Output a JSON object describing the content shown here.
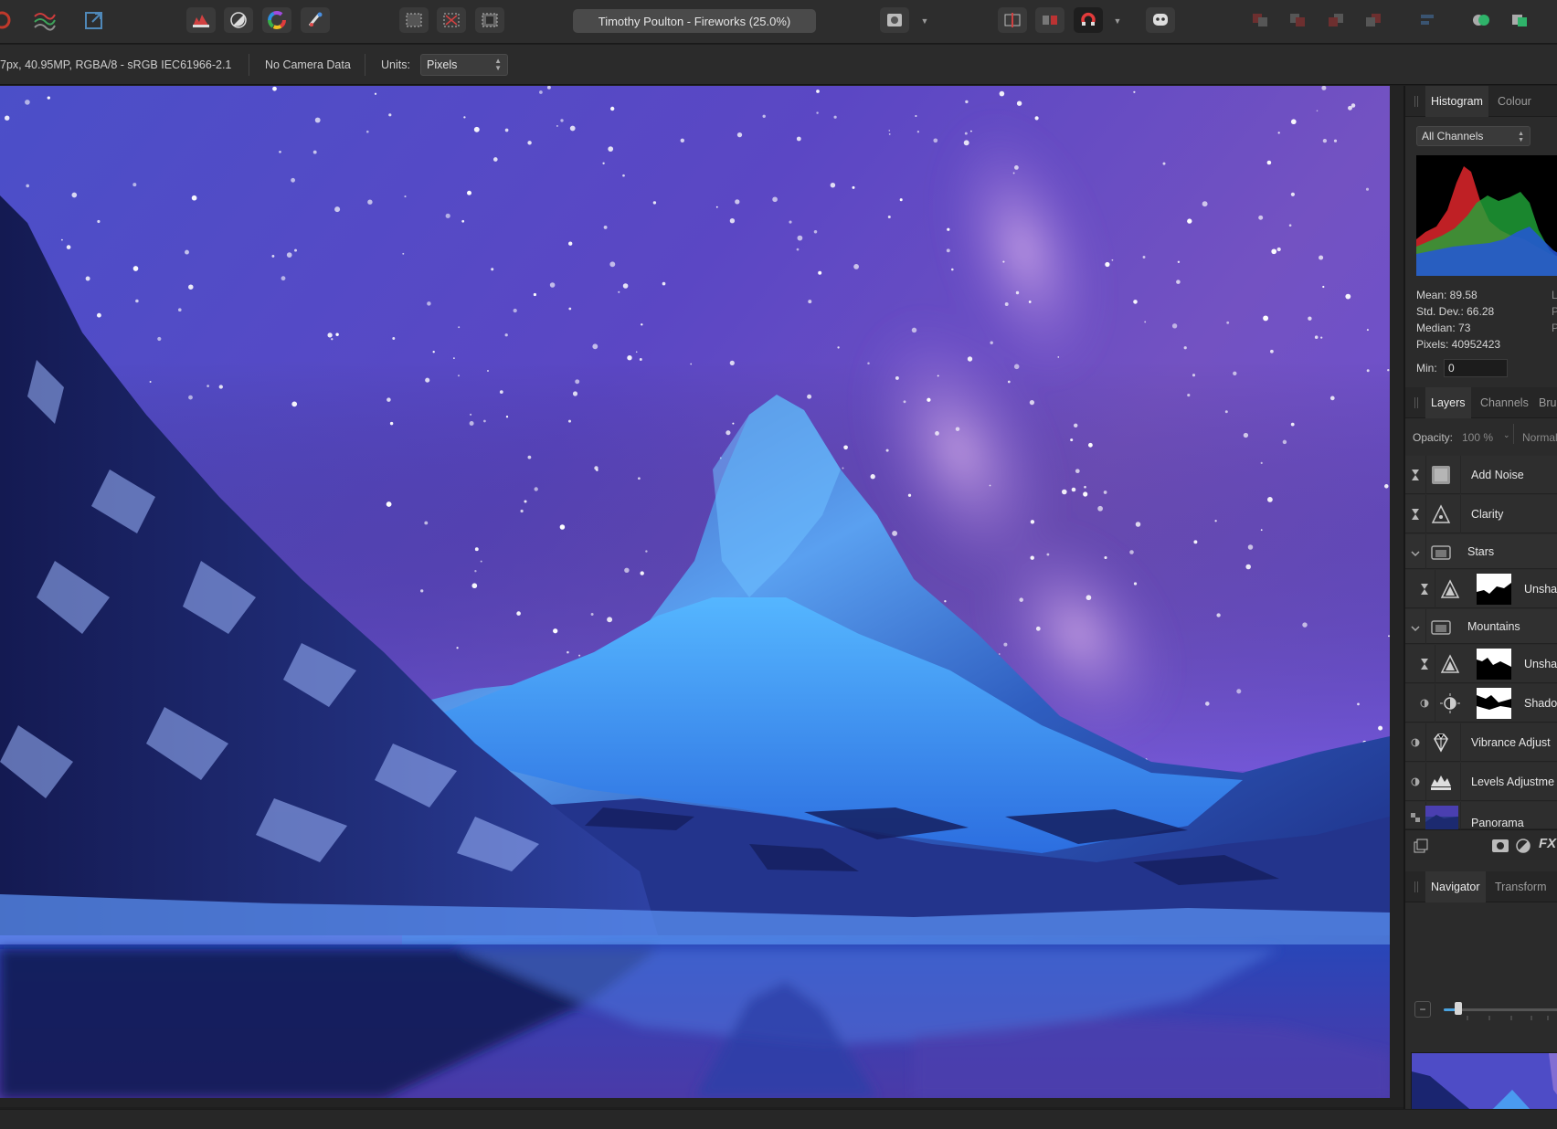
{
  "toolbar": {
    "document_title": "Timothy Poulton - Fireworks (25.0%)",
    "icons": [
      "personas-icon",
      "develop-persona-icon",
      "export-persona-icon",
      "levels-icon",
      "white-balance-icon",
      "colour-wheel-icon",
      "brush-tools-icon",
      "marquee-select-icon",
      "deselect-icon",
      "invert-selection-icon",
      "quick-mask-icon",
      "split-view-icon",
      "mirror-view-icon",
      "snapping-icon",
      "assistant-icon",
      "arrange-back-icon",
      "arrange-backward-icon",
      "arrange-forward-icon",
      "arrange-front-icon",
      "align-icon",
      "boolean-add-icon",
      "boolean-subtract-icon"
    ]
  },
  "context_bar": {
    "image_info": "7px, 40.95MP, RGBA/8 - sRGB IEC61966-2.1",
    "camera": "No Camera Data",
    "units_label": "Units:",
    "units_value": "Pixels"
  },
  "histogram_panel": {
    "tabs": [
      "Histogram",
      "Colour"
    ],
    "active_tab": "Histogram",
    "channel_select": "All Channels",
    "mean": "Mean: 89.58",
    "std_dev": "Std. Dev.: 66.28",
    "median": "Median: 73",
    "pixels": "Pixels: 40952423",
    "min_label": "Min:",
    "min_value": "0",
    "right_col": [
      "L",
      "P",
      "P"
    ],
    "colors": {
      "red": "#e1262b",
      "green": "#21a73a",
      "blue": "#2556d8"
    }
  },
  "layers_panel": {
    "tabs": [
      "Layers",
      "Channels",
      "Bru"
    ],
    "active_tab": "Layers",
    "opacity_label": "Opacity:",
    "opacity_value": "100 %",
    "blend_mode": "Normal",
    "layers": [
      {
        "name": "Add Noise",
        "icon": "noise-filter-icon"
      },
      {
        "name": "Clarity",
        "icon": "clarity-filter-icon"
      },
      {
        "name": "Stars",
        "icon": "group-folder-icon"
      },
      {
        "name": "Unsha",
        "icon": "unsharp-mask-icon"
      },
      {
        "name": "Mountains",
        "icon": "group-folder-icon"
      },
      {
        "name": "Unsha",
        "icon": "unsharp-mask-icon"
      },
      {
        "name": "Shado",
        "icon": "shadows-highlights-icon"
      },
      {
        "name": "Vibrance Adjust",
        "icon": "vibrance-icon"
      },
      {
        "name": "Levels Adjustme",
        "icon": "levels-adjustment-icon"
      },
      {
        "name": "Panorama",
        "icon": "pixel-layer-icon"
      }
    ],
    "footer_icons": [
      "layers-stack-icon",
      "mask-icon",
      "adjustment-icon",
      "fx-icon"
    ],
    "fx_label": "FX"
  },
  "navigator_panel": {
    "tabs": [
      "Navigator",
      "Transform"
    ],
    "active_tab": "Navigator",
    "zoom_fraction": 0.12
  }
}
